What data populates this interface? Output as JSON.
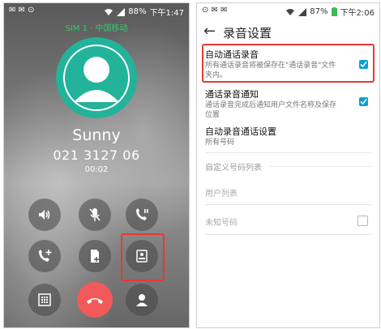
{
  "call_screen": {
    "status_bar": {
      "left": "✉ ✉ ⊙",
      "battery": "88%",
      "time": "下午1:47"
    },
    "sim_label": "SIM 1 · 中国移动",
    "contact_name": "Sunny",
    "phone_number": "021 3127 06",
    "call_timer": "00:02",
    "buttons": [
      "speaker-icon",
      "mute-icon",
      "hold-icon",
      "add-call-icon",
      "transfer-icon",
      "record-icon",
      "keypad-icon",
      "end-call-icon",
      "contact-icon"
    ]
  },
  "settings": {
    "status_bar": {
      "left": "⊙ ✉ ✉",
      "battery": "87%",
      "time": "下午2:06"
    },
    "title": "录音设置",
    "items": [
      {
        "title": "自动通话录音",
        "subtitle": "所有通话录音将被保存在\"通话录音\"文件夹内。",
        "checked": true
      },
      {
        "title": "通话录音通知",
        "subtitle": "通话录音完成后通知用户文件名称及保存位置",
        "checked": true
      },
      {
        "title": "自动录音通话设置",
        "subtitle": "所有号码"
      }
    ],
    "custom_list_header": "自定义号码列表",
    "user_list": "用户列表",
    "unknown_numbers": "未知号码",
    "unknown_checked": false,
    "accent_color": "#0c9fd6",
    "highlight_color": "#e53935"
  }
}
